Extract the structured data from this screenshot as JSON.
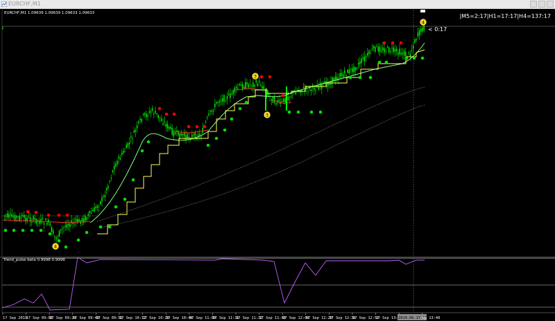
{
  "window": {
    "title": "EURCHF,M1"
  },
  "header": {
    "symbol_info": "EURCHF,M1 1.09639 1.09639 1.09633 1.09633",
    "timeframe_readout": "|M5=2:17|H1=17:17|H4=137:17",
    "bar_countdown": "< 0:17"
  },
  "indicator": {
    "label": "Trend_pulse beta 0.9998 0.9998"
  },
  "markers": [
    {
      "text": "4"
    },
    {
      "text": "3"
    },
    {
      "text": "3"
    },
    {
      "text": "4"
    }
  ],
  "time_axis": {
    "labels": [
      "17 Sep 2019",
      "17 Sep 09:08",
      "17 Sep 09:24",
      "17 Sep 09:40",
      "17 Sep 09:56",
      "17 Sep 10:12",
      "17 Sep 10:28",
      "17 Sep 10:44",
      "17 Sep 11:00",
      "17 Sep 11:16",
      "17 Sep 11:32",
      "17 Sep 11:48",
      "17 Sep 12:04",
      "17 Sep 12:20",
      "17 Sep 12:36",
      "17 Sep 12:52",
      "17 Sep 13:08",
      "2019.09.17 13:40",
      "ep 13:40"
    ],
    "highlight": "2019.09.17 13:40"
  },
  "colors": {
    "candles": "#00ff00",
    "fast_line": "#ff3030",
    "slow_line": "#ffff60",
    "trend_line": "#80ff80",
    "ma_dotted": "#9a9a9a",
    "dot_up": "#00e000",
    "dot_down": "#ff0000",
    "oscillator": "#c060ff",
    "marker": "#ffd200"
  }
}
